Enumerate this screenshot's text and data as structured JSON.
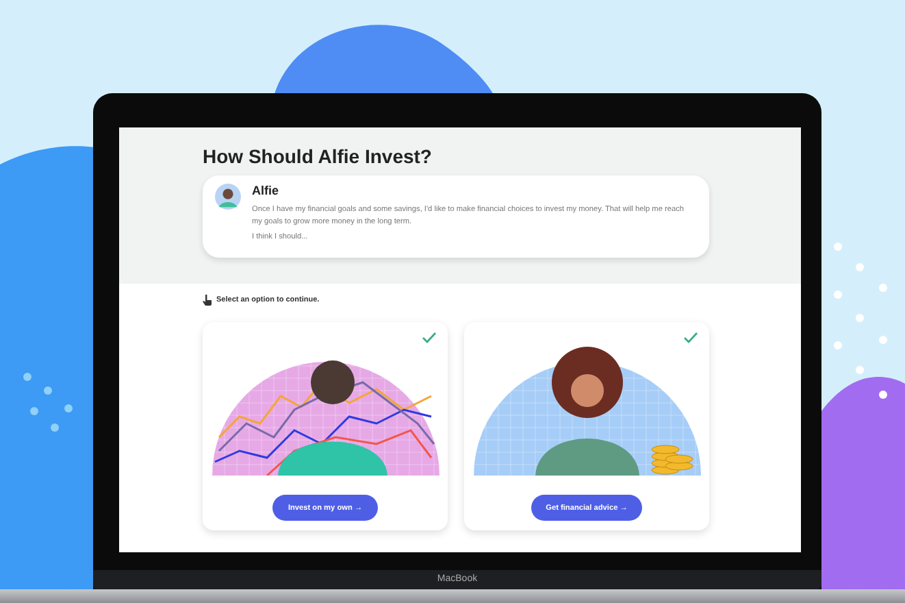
{
  "page": {
    "title": "How Should Alfie Invest?",
    "message": {
      "name": "Alfie",
      "text": "Once I have my financial goals and some savings, I'd like to make financial choices to invest my money. That will help me reach my goals to grow more money in the long term.",
      "prompt": "I think I should..."
    },
    "instruction": "Select an option to continue.",
    "options": [
      {
        "kind": "own",
        "label": "Invest on my own →"
      },
      {
        "kind": "advice",
        "label": "Get financial advice →"
      }
    ]
  },
  "device": {
    "label": "MacBook"
  }
}
